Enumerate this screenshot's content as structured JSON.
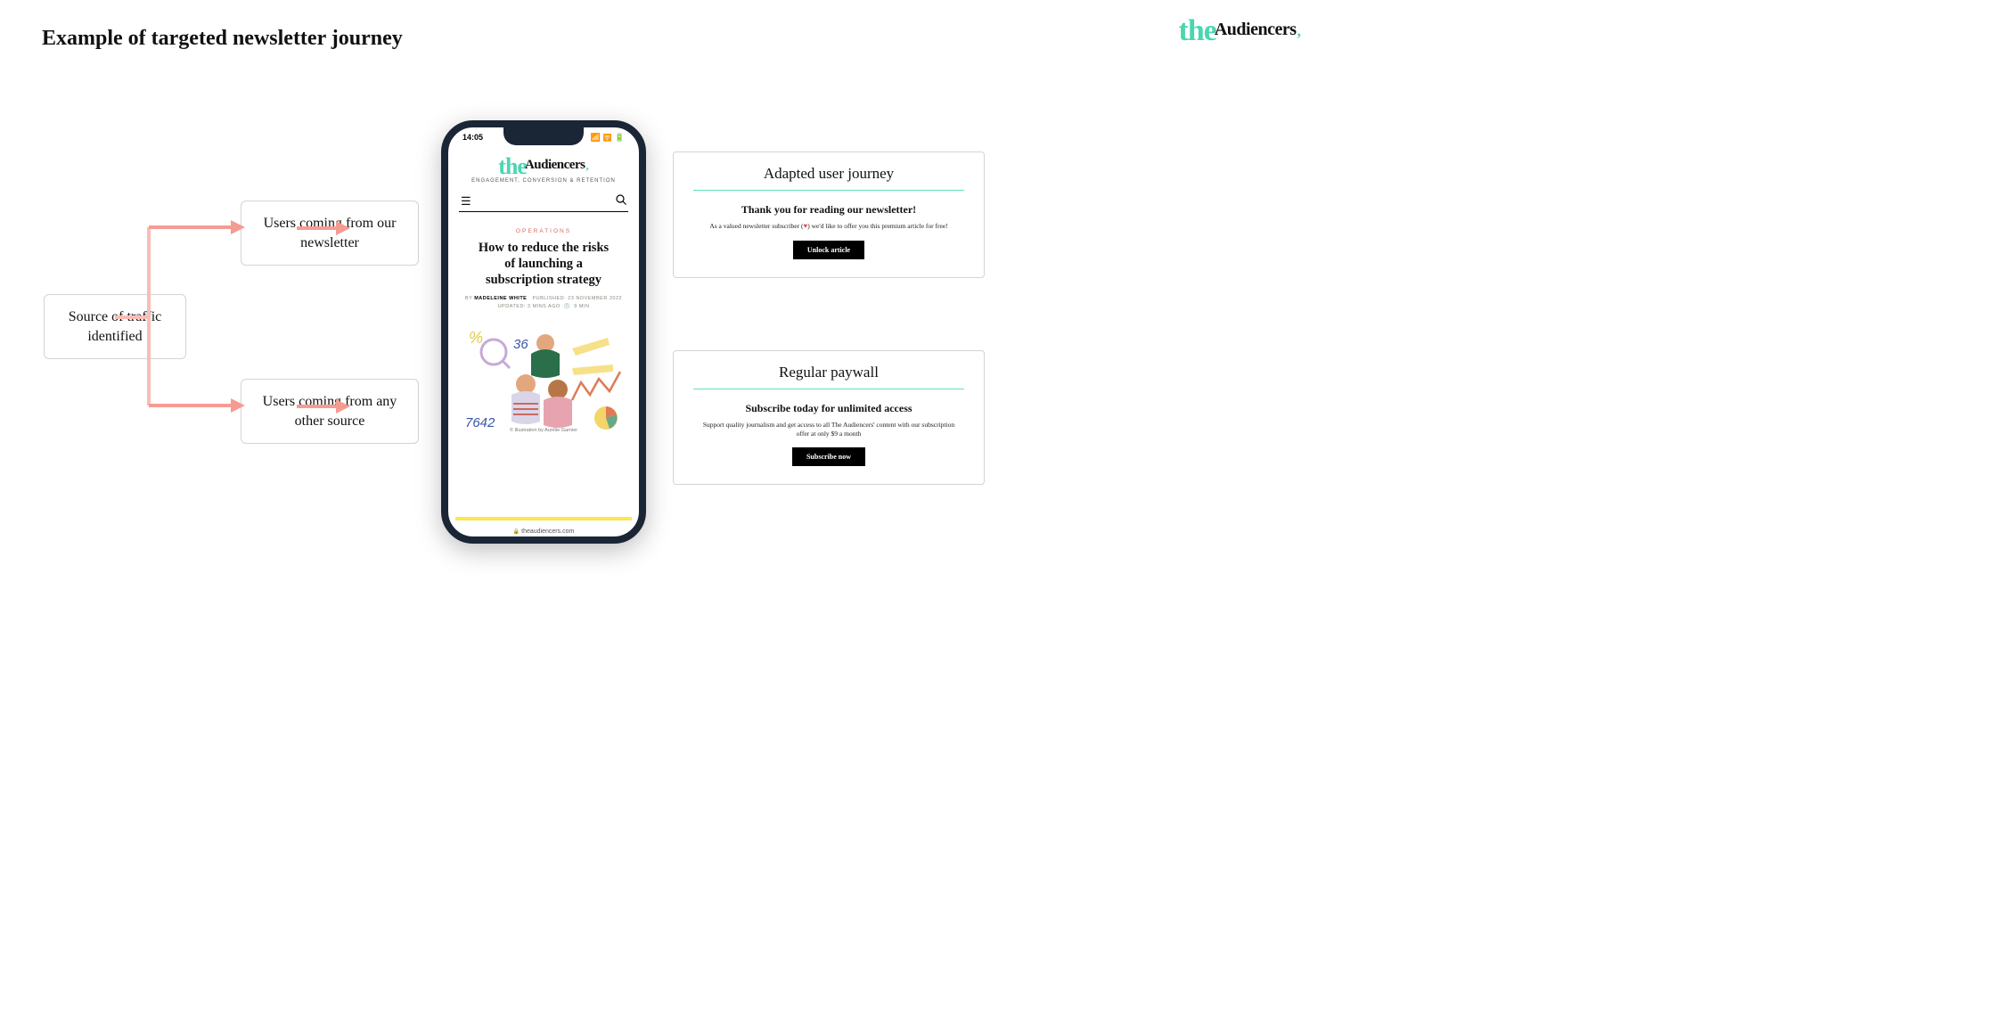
{
  "slide_title": "Example of targeted newsletter journey",
  "brand": {
    "the": "the",
    "audiencers": "Audiencers",
    "comma": ","
  },
  "flow": {
    "start": "Source of traffic identified",
    "branch_newsletter": "Users coming from our newsletter",
    "branch_other": "Users coming from any other source"
  },
  "phone": {
    "time": "14:05",
    "tagline": "ENGAGEMENT, CONVERSION & RETENTION",
    "category": "OPERATIONS",
    "article_title": "How to reduce the risks of launching a subscription strategy",
    "byline_prefix": "BY",
    "author": "MADELEINE WHITE",
    "published_label": "PUBLISHED:",
    "published_value": "23 NOVEMBER 2022",
    "updated_label": "UPDATED:",
    "updated_value": "3 MINS AGO",
    "read_time": "9 MIN",
    "illustration_credit": "© Illustration by Aurélie Garnier",
    "url": "theaudiencers.com"
  },
  "cards": {
    "adapted": {
      "title": "Adapted user journey",
      "headline": "Thank you for reading our newsletter!",
      "body_before": "As a valued newsletter subscriber (",
      "body_after": ") we'd like to offer you this premium article for free!",
      "cta": "Unlock article"
    },
    "regular": {
      "title": "Regular paywall",
      "headline": "Subscribe today for unlimited access",
      "body": "Support quality journalism and get access to all The Audiencers' content with our subscription offer at only $9 a month",
      "cta": "Subscribe now"
    }
  }
}
